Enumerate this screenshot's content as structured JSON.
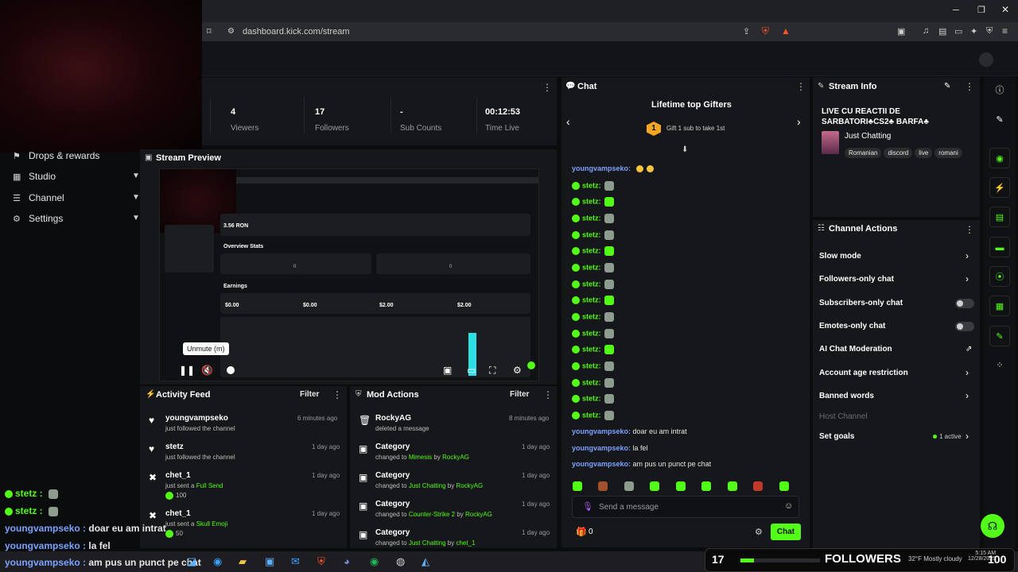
{
  "browser": {
    "url": "dashboard.kick.com/stream"
  },
  "nav": [
    {
      "label": "Drops & rewards",
      "icon": "gift-icon"
    },
    {
      "label": "Studio",
      "icon": "layout-icon"
    },
    {
      "label": "Channel",
      "icon": "list-icon"
    },
    {
      "label": "Settings",
      "icon": "gear-icon"
    }
  ],
  "stats": [
    {
      "value": "4",
      "label": "Viewers"
    },
    {
      "value": "17",
      "label": "Followers"
    },
    {
      "value": "-",
      "label": "Sub Counts"
    },
    {
      "value": "00:12:53",
      "label": "Time Live"
    }
  ],
  "preview": {
    "title": "Stream Preview",
    "tooltip": "Unmute (m)",
    "mini_amount": "3.56 RON",
    "mini_overview": "Overview Stats",
    "mini_earnings": "Earnings",
    "mini_values": [
      "$0.00",
      "$0.00",
      "$2.00",
      "$2.00"
    ],
    "mini_zero": "0"
  },
  "activity": {
    "title": "Activity Feed",
    "filter": "Filter",
    "items": [
      {
        "name": "youngvampseko",
        "sub": "just followed the channel",
        "time": "6 minutes ago",
        "extra": ""
      },
      {
        "name": "stetz",
        "sub": "just followed the channel",
        "time": "1 day ago",
        "extra": ""
      },
      {
        "name": "chet_1",
        "sub": "just sent a",
        "sub_hl": "Full Send",
        "time": "1 day ago",
        "extra": "100"
      },
      {
        "name": "chet_1",
        "sub": "just sent a",
        "sub_hl": "Skull Emoji",
        "time": "1 day ago",
        "extra": "50"
      }
    ]
  },
  "mod": {
    "title": "Mod Actions",
    "filter": "Filter",
    "items": [
      {
        "name": "RockyAG",
        "sub": "deleted a message",
        "time": "8 minutes ago"
      },
      {
        "name": "Category",
        "pre": "changed to",
        "hl": "Mimesis",
        "by": "by",
        "who": "RockyAG",
        "time": "1 day ago"
      },
      {
        "name": "Category",
        "pre": "changed to",
        "hl": "Just Chatting",
        "by": "by",
        "who": "RockyAG",
        "time": "1 day ago"
      },
      {
        "name": "Category",
        "pre": "changed to",
        "hl": "Counter-Strike 2",
        "by": "by",
        "who": "RockyAG",
        "time": "1 day ago"
      },
      {
        "name": "Category",
        "pre": "changed to",
        "hl": "Just Chatting",
        "by": "by",
        "who": "chet_1",
        "time": "1 day ago"
      }
    ]
  },
  "chat": {
    "title": "Chat",
    "gifters_title": "Lifetime top Gifters",
    "gift_rank": "1",
    "gift_text": "Gift 1 sub to take 1st",
    "first_user": "youngvampseko:",
    "statz_user": "stetz:",
    "lines": [
      {
        "user": "youngvampseko:",
        "text": "doar eu am intrat"
      },
      {
        "user": "youngvampseko:",
        "text": "la fel"
      },
      {
        "user": "youngvampseko:",
        "text": "am pus un punct pe chat"
      }
    ],
    "placeholder": "Send a message",
    "count": "0",
    "send": "Chat"
  },
  "stream_info": {
    "title": "Stream Info",
    "stream_title": "LIVE CU REACTII DE SARBATORI♣CS2♣ BARFA♣",
    "category": "Just Chatting",
    "tags": [
      "Romanian",
      "discord",
      "live",
      "romani"
    ]
  },
  "channel_actions": {
    "title": "Channel Actions",
    "items": [
      {
        "label": "Slow mode",
        "control": "arrow"
      },
      {
        "label": "Followers-only chat",
        "control": "arrow"
      },
      {
        "label": "Subscribers-only chat",
        "control": "toggle"
      },
      {
        "label": "Emotes-only chat",
        "control": "toggle"
      },
      {
        "label": "AI Chat Moderation",
        "control": "external"
      },
      {
        "label": "Account age restriction",
        "control": "arrow"
      },
      {
        "label": "Banned words",
        "control": "arrow"
      },
      {
        "label": "Host Channel",
        "control": "none"
      },
      {
        "label": "Set goals",
        "control": "arrow"
      }
    ],
    "goals_status": "1 active"
  },
  "overlay": {
    "chat_lines": [
      {
        "user": "stetz :",
        "text": ""
      },
      {
        "user": "stetz :",
        "text": ""
      },
      {
        "user": "youngvampseko :",
        "text": "doar eu am intrat"
      },
      {
        "user": "youngvampseko :",
        "text": "la fel"
      },
      {
        "user": "youngvampseko :",
        "text": "am pus un punct pe chat"
      }
    ],
    "followers_count": "17",
    "followers_label": "FOLLOWERS",
    "followers_goal": "100"
  },
  "taskbar": {
    "weather": "32°F",
    "weather_desc": "Mostly cloudy",
    "time": "5:15 AM",
    "date": "12/28/2025"
  },
  "colors": {
    "accent": "#53fc18",
    "bg": "#0b0c0e",
    "panel": "#16171a"
  }
}
